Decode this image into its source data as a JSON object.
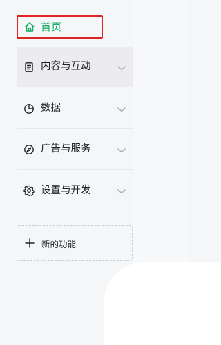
{
  "sidebar": {
    "home": {
      "label": "首页",
      "icon": "home-icon",
      "color": "#1aad63"
    },
    "items": [
      {
        "label": "内容与互动",
        "icon": "document-icon",
        "active": true
      },
      {
        "label": "数据",
        "icon": "pie-chart-icon",
        "active": false
      },
      {
        "label": "广告与服务",
        "icon": "compass-icon",
        "active": false
      },
      {
        "label": "设置与开发",
        "icon": "gear-icon",
        "active": false
      }
    ],
    "new_feature": {
      "label": "新的功能",
      "icon": "plus-icon"
    }
  },
  "colors": {
    "accent": "#1aad63",
    "highlight_border": "#e02424",
    "active_bg": "#ececee"
  }
}
